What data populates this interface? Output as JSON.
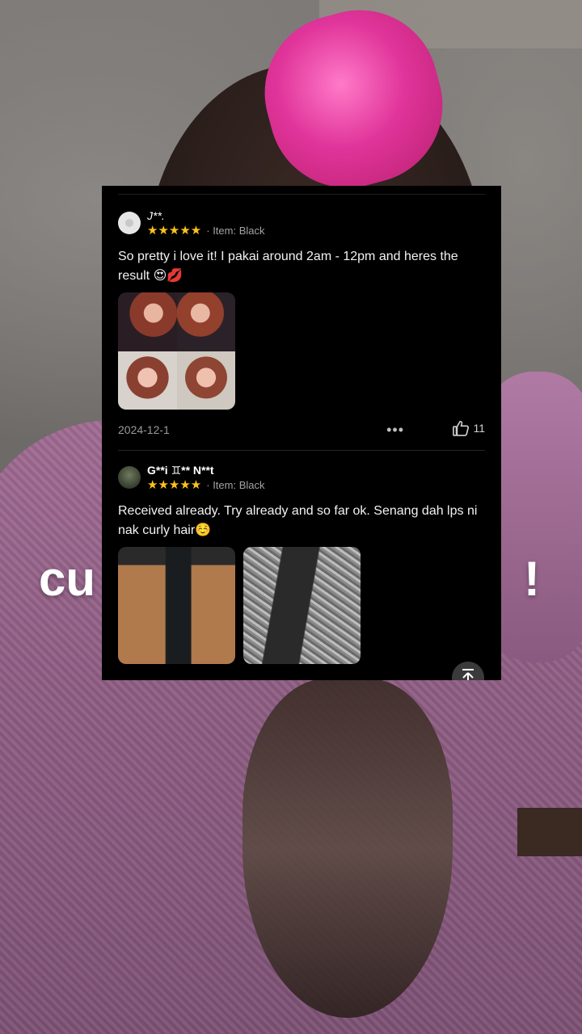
{
  "overlay": {
    "left_text": "cu",
    "right_text": "!"
  },
  "reviews": [
    {
      "username": "J**.",
      "stars": "★★★★★",
      "variant": "· Item: Black",
      "text": "So pretty i love it! I pakai around 2am - 12pm and heres the result 😍💋",
      "date": "2024-12-1",
      "more": "•••",
      "likes": "11"
    },
    {
      "username": "G**i ♊** N**t",
      "stars": "★★★★★",
      "variant": "· Item: Black",
      "text": "Received already. Try already and so far ok. Senang dah lps ni nak curly hair☺️"
    }
  ],
  "icons": {
    "like": "thumbs-up-icon",
    "more": "more-icon",
    "scroll_top": "scroll-to-top-icon"
  },
  "colors": {
    "star": "#ffc21a",
    "panel_bg": "#000000"
  }
}
